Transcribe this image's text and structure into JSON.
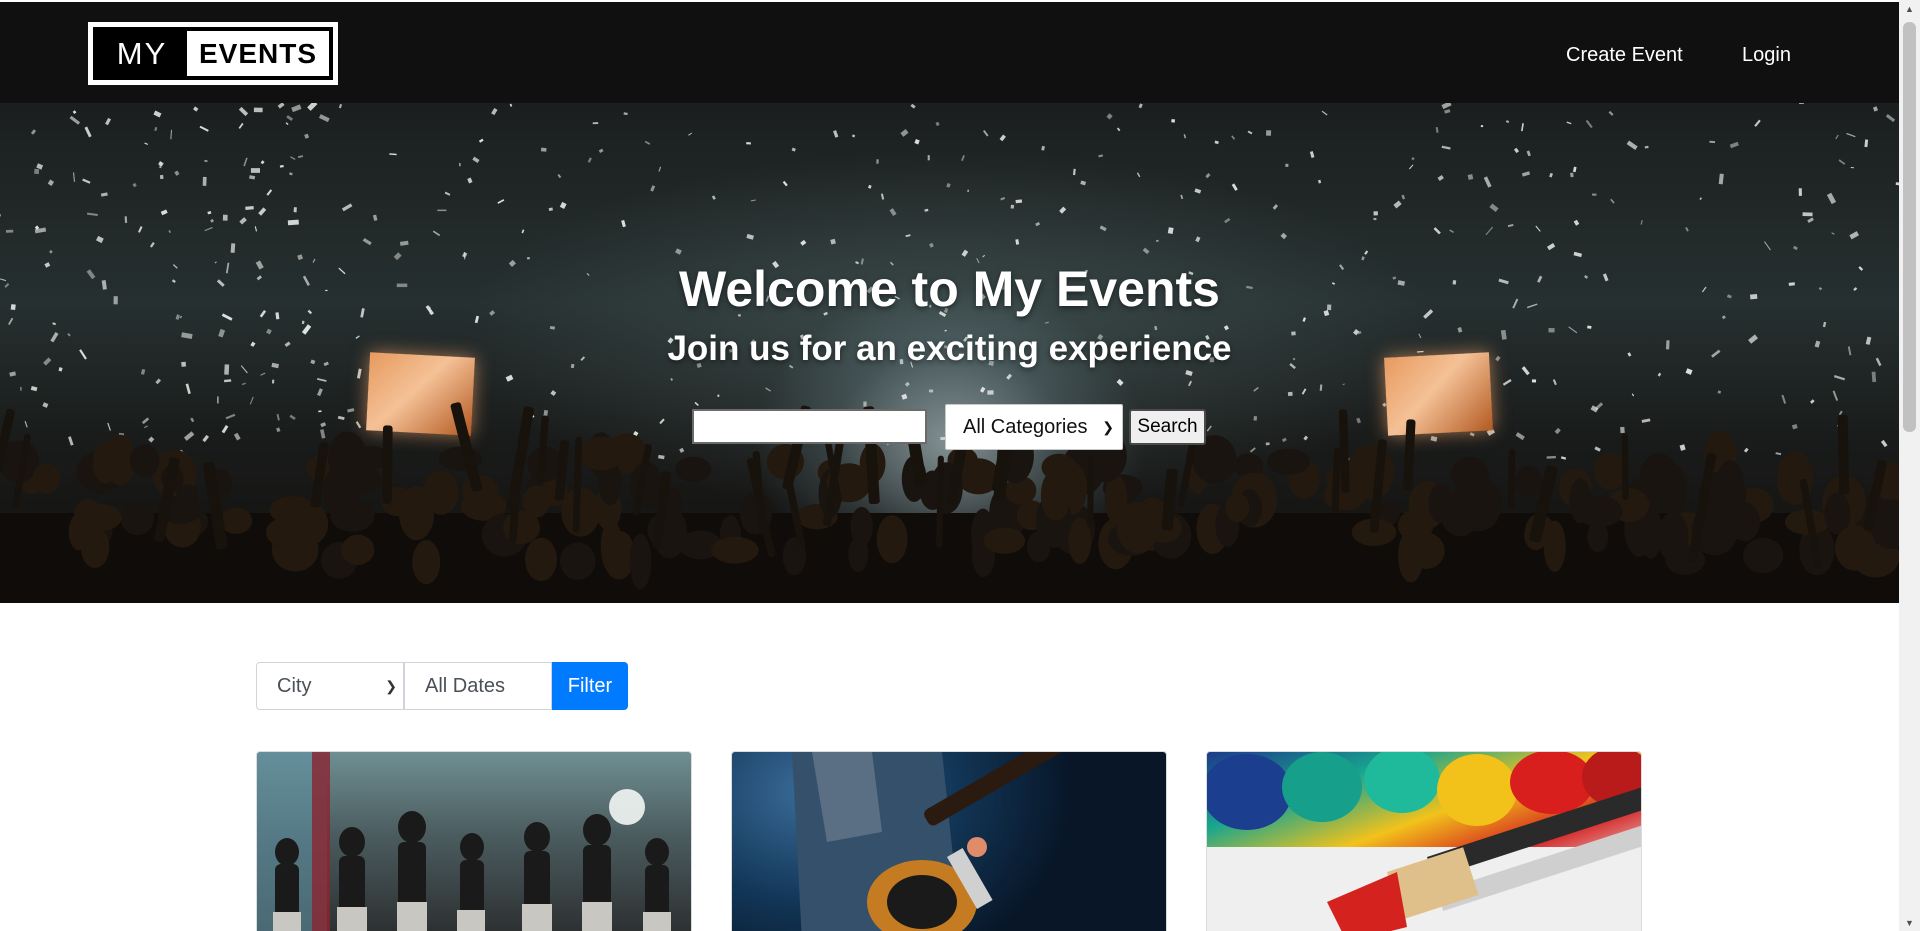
{
  "brand": {
    "logo_left": "MY",
    "logo_right": "EVENTS"
  },
  "nav": {
    "create_event": "Create Event",
    "login": "Login"
  },
  "hero": {
    "title": "Welcome to My Events",
    "subtitle": "Join us for an exciting experience",
    "search_value": "",
    "category_selected": "All Categories",
    "search_button": "Search"
  },
  "filters": {
    "city_selected": "City",
    "dates_value": "All Dates",
    "filter_button": "Filter"
  },
  "cards": [
    {
      "image": "dancers-performing-on-stage"
    },
    {
      "image": "guitarist-on-stage"
    },
    {
      "image": "paint-tubes-and-brushes"
    }
  ],
  "colors": {
    "navbar": "#111011",
    "primary": "#007bff",
    "text_light": "#ffffff"
  }
}
